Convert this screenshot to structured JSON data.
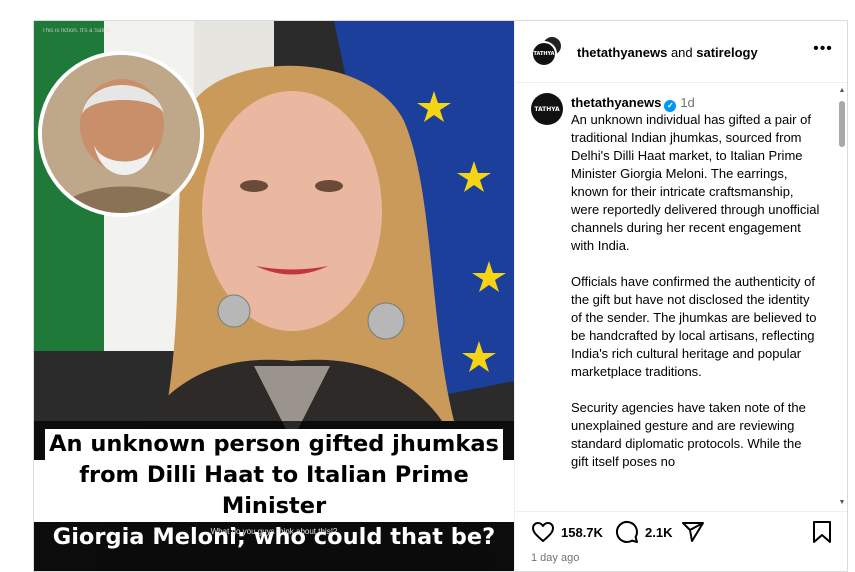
{
  "media": {
    "disclaimer": "This is fiction. It's a Satire.",
    "headline_lines": [
      "An unknown person gifted jhumkas",
      "from Dilli Haat to Italian Prime Minister",
      "Giorgia Meloni; who could that be?"
    ],
    "subline": "What do you guys think about this!?"
  },
  "header": {
    "avatar_text": "TATHYA",
    "account": "thetathyanews",
    "joiner": "and",
    "collaborator": "satirelogy",
    "more_label": "•••"
  },
  "post": {
    "avatar_text": "TATHYA",
    "username": "thetathyanews",
    "verified_icon": "verified-badge-icon",
    "time": "1d",
    "paragraphs": [
      "An unknown individual has gifted a pair of traditional Indian jhumkas, sourced from Delhi's Dilli Haat market, to Italian Prime Minister Giorgia Meloni. The earrings, known for their intricate craftsmanship, were reportedly delivered through unofficial channels during her recent engagement with India.",
      "Officials have confirmed the authenticity of the gift but have not disclosed the identity of the sender. The jhumkas are believed to be handcrafted by local artisans, reflecting India's rich cultural heritage and popular marketplace traditions.",
      "Security agencies have taken note of the unexplained gesture and are reviewing standard diplomatic protocols. While the gift itself poses no"
    ]
  },
  "actions": {
    "likes": "158.7K",
    "comments": "2.1K",
    "time_ago": "1 day ago",
    "icons": [
      "heart-icon",
      "comment-icon",
      "share-icon",
      "bookmark-icon"
    ]
  },
  "colors": {
    "verified": "#0095f6",
    "muted_text": "#737373",
    "border": "#dbdbdb"
  }
}
